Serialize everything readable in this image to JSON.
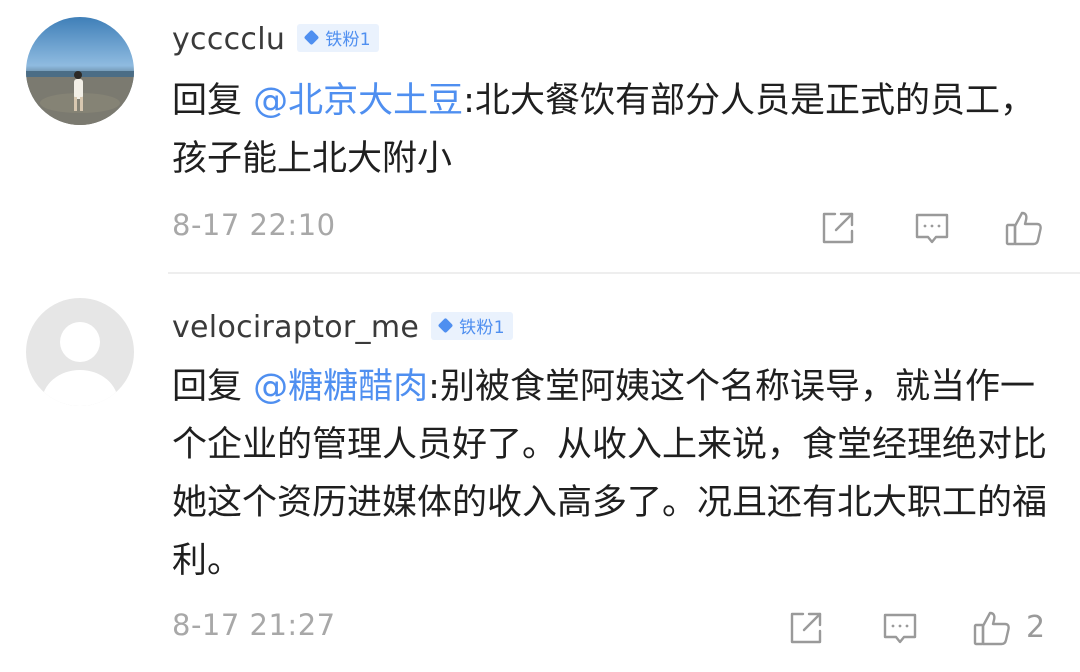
{
  "comments": [
    {
      "username": "ycccclu",
      "badge": "铁粉1",
      "reply_prefix": "回复 ",
      "mention": "@北京大土豆",
      "text": ":北大餐饮有部分人员是正式的员工，孩子能上北大附小",
      "time": "8-17 22:10",
      "likes": ""
    },
    {
      "username": "velociraptor_me",
      "badge": "铁粉1",
      "reply_prefix": "回复 ",
      "mention": "@糖糖醋肉",
      "text": ":别被食堂阿姨这个名称误导，就当作一个企业的管理人员好了。从收入上来说，食堂经理绝对比她这个资历进媒体的收入高多了。况且还有北大职工的福利。",
      "time": "8-17 21:27",
      "likes": "2"
    }
  ],
  "icons": {
    "share": "share-icon",
    "comment": "comment-icon",
    "like": "like-icon"
  },
  "colors": {
    "mention": "#4f8ff0",
    "badge_bg": "#eaf2fd",
    "meta_text": "#a8a8a8"
  }
}
